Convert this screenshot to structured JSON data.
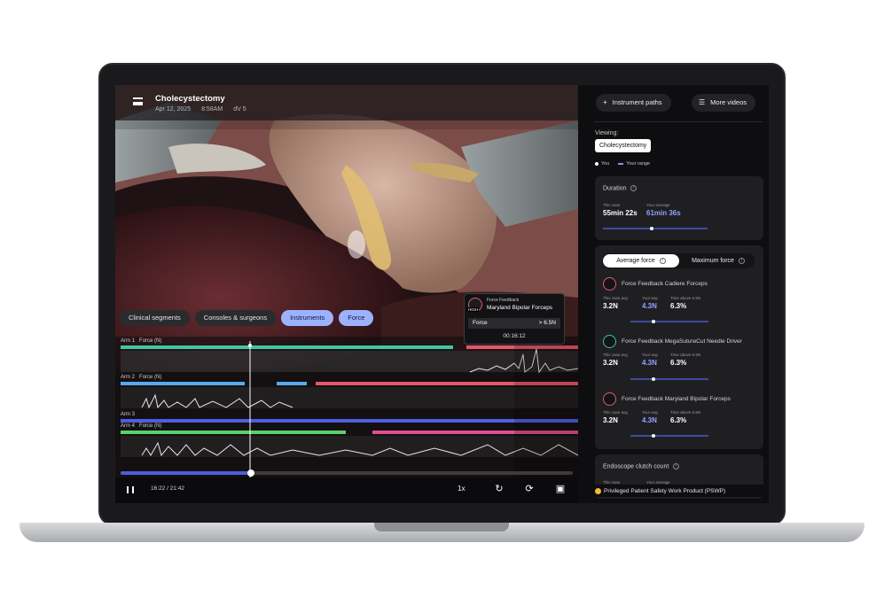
{
  "header": {
    "title": "Cholecystectomy",
    "date": "Apr 12, 2025",
    "time": "8:58AM",
    "system": "dV 5"
  },
  "chips": [
    "Clinical segments",
    "Consoles & surgeons",
    "Instruments",
    "Force"
  ],
  "tooltip": {
    "caption": "Force Feedback",
    "instrument": "Maryland Bipolar Forceps",
    "badge": "HIGH",
    "metric": "Force",
    "value": "> 6.5N",
    "timestamp": "00:16:12"
  },
  "tracks": {
    "arm1": {
      "label": "Arm 1",
      "unit": "Force (N)"
    },
    "arm2": {
      "label": "Arm 2",
      "unit": "Force (N)"
    },
    "arm3": {
      "label": "Arm 3"
    },
    "arm4": {
      "label": "Arm 4",
      "unit": "Force (N)"
    },
    "colors": {
      "teal": "#3ec7a6",
      "red": "#e4566c",
      "blue": "#5aa8ee",
      "indigo": "#4d5ee0",
      "green": "#58d36a",
      "pink": "#e0508c"
    }
  },
  "playback": {
    "time": "16:22 / 21:42",
    "speed": "1x",
    "progress": 0.315
  },
  "panel": {
    "instrument_paths": "Instrument paths",
    "more_videos": "More videos",
    "viewing_label": "Viewing:",
    "viewing_value": "Cholecystectomy",
    "legend_you": "You",
    "legend_range": "Your range",
    "duration": {
      "title": "Duration",
      "case_label": "This case",
      "case_value": "55min 22s",
      "avg_label": "Your average",
      "avg_value": "61min 36s"
    },
    "force_tabs": {
      "active": "Average force",
      "inactive": "Maximum force"
    },
    "instruments": [
      {
        "name": "Force Feedback Cadiere Forceps",
        "case_label": "This case avg",
        "case_value": "3.2N",
        "avg_label": "Your avg",
        "avg_value": "4.3N",
        "time_label": "Time above 6.5N",
        "time_value": "6.3%"
      },
      {
        "name": "Force Feedback MegaSutureCut Needle Driver",
        "case_label": "This case avg",
        "case_value": "3.2N",
        "avg_label": "Your avg",
        "avg_value": "4.3N",
        "time_label": "Time above 6.5N",
        "time_value": "6.3%"
      },
      {
        "name": "Force Feedback Maryland Bipolar Forceps",
        "case_label": "This case avg",
        "case_value": "3.2N",
        "avg_label": "Your avg",
        "avg_value": "4.3N",
        "time_label": "Time above 6.5N",
        "time_value": "6.3%"
      }
    ],
    "endoscope": {
      "title": "Endoscope clutch count",
      "case_label": "This case",
      "avg_label": "Your average"
    },
    "footer": "Privileged Patient Safety Work Product (PSWP)"
  },
  "icons": {
    "menu": "hamburger-icon",
    "pause": "pause-icon",
    "replay": "replay-icon",
    "loop": "loop-icon",
    "expand": "export-icon",
    "plus": "plus-icon",
    "list": "list-icon",
    "info": "info-icon",
    "warning": "warning-icon"
  }
}
